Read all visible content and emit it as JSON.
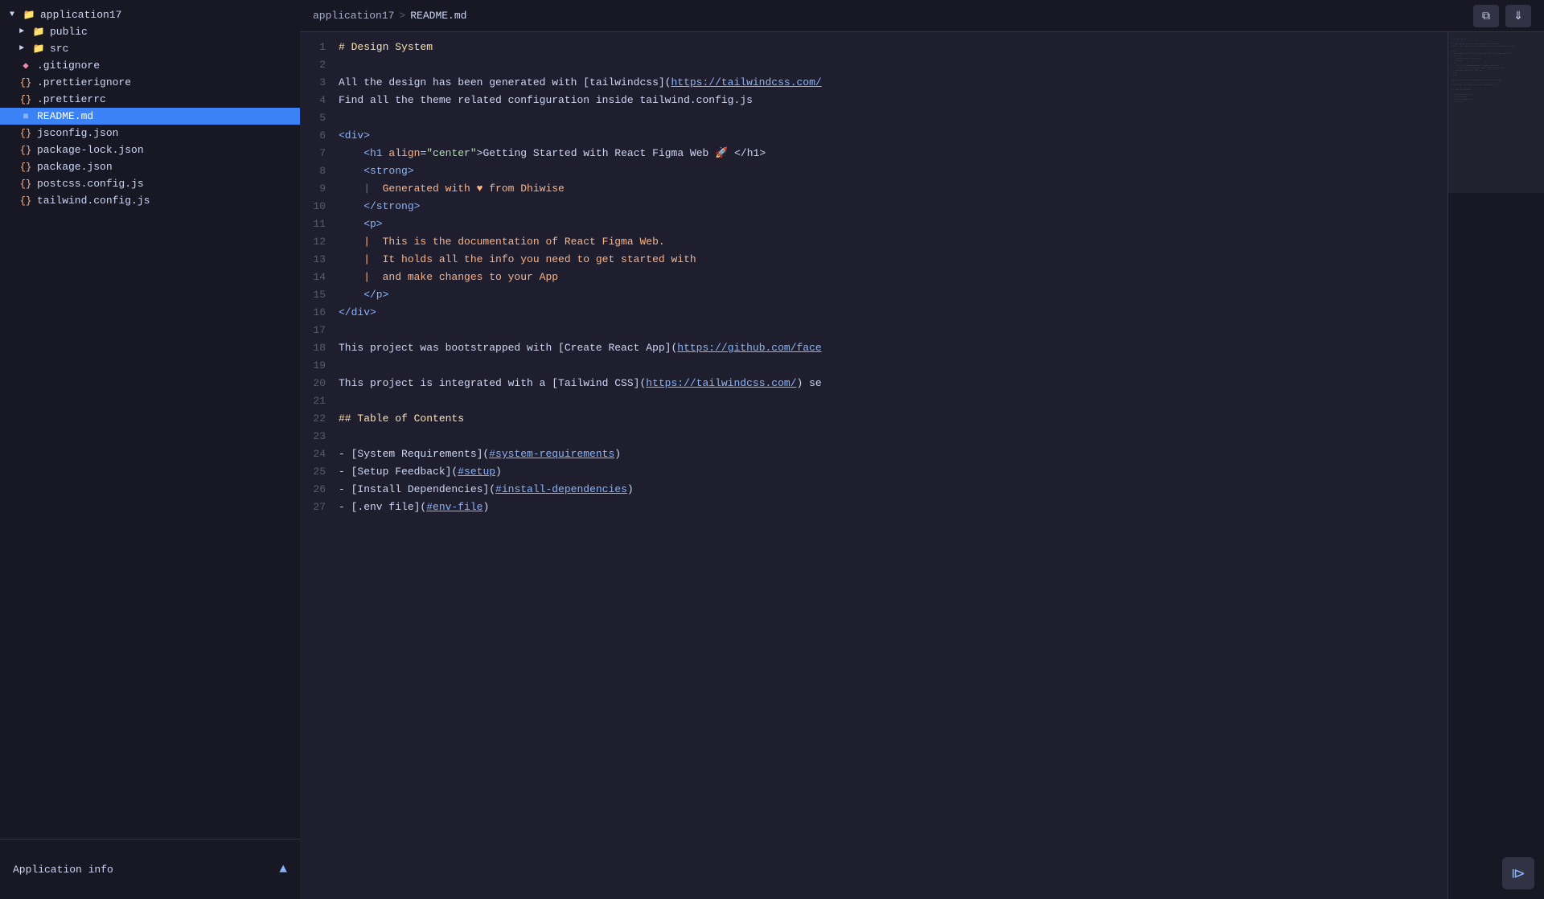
{
  "breadcrumb": {
    "root": "application17",
    "separator": ">",
    "file": "README.md"
  },
  "sidebar": {
    "title": "application17",
    "items": [
      {
        "id": "application17",
        "label": "application17",
        "type": "folder",
        "expanded": true,
        "indent": 0
      },
      {
        "id": "public",
        "label": "public",
        "type": "folder",
        "expanded": false,
        "indent": 1
      },
      {
        "id": "src",
        "label": "src",
        "type": "folder",
        "expanded": false,
        "indent": 1
      },
      {
        "id": "gitignore",
        "label": ".gitignore",
        "type": "diamond",
        "expanded": false,
        "indent": 1
      },
      {
        "id": "prettierignore",
        "label": ".prettierignore",
        "type": "braces",
        "expanded": false,
        "indent": 1
      },
      {
        "id": "prettierrc",
        "label": ".prettierrc",
        "type": "braces",
        "expanded": false,
        "indent": 1
      },
      {
        "id": "readmemd",
        "label": "README.md",
        "type": "circle",
        "expanded": false,
        "indent": 1,
        "active": true
      },
      {
        "id": "jsconfigjson",
        "label": "jsconfig.json",
        "type": "braces",
        "expanded": false,
        "indent": 1
      },
      {
        "id": "packagelockjson",
        "label": "package-lock.json",
        "type": "braces",
        "expanded": false,
        "indent": 1
      },
      {
        "id": "packagejson",
        "label": "package.json",
        "type": "braces",
        "expanded": false,
        "indent": 1
      },
      {
        "id": "postcssconfig",
        "label": "postcss.config.js",
        "type": "braces",
        "expanded": false,
        "indent": 1
      },
      {
        "id": "tailwindconfig",
        "label": "tailwind.config.js",
        "type": "braces",
        "expanded": false,
        "indent": 1
      }
    ],
    "footer": {
      "label": "Application info",
      "chevron": "^"
    }
  },
  "editor": {
    "lines": [
      {
        "num": 1,
        "tokens": [
          {
            "text": "# Design System",
            "class": "c-heading"
          }
        ]
      },
      {
        "num": 2,
        "tokens": []
      },
      {
        "num": 3,
        "tokens": [
          {
            "text": "All the design has been generated with [tailwindcss](",
            "class": "c-white"
          },
          {
            "text": "https://tailwindcss.com/",
            "class": "c-link"
          }
        ]
      },
      {
        "num": 4,
        "tokens": [
          {
            "text": "Find all the theme related configuration inside tailwind.config.js",
            "class": "c-white"
          }
        ]
      },
      {
        "num": 5,
        "tokens": []
      },
      {
        "num": 6,
        "tokens": [
          {
            "text": "<div>",
            "class": "c-tag"
          }
        ]
      },
      {
        "num": 7,
        "tokens": [
          {
            "text": "    <h1 ",
            "class": "c-tag"
          },
          {
            "text": "align",
            "class": "c-attr-name"
          },
          {
            "text": "=",
            "class": "c-white"
          },
          {
            "text": "\"center\"",
            "class": "c-attr-val"
          },
          {
            "text": ">Getting Started with React Figma Web 🚀 </h1>",
            "class": "c-inner"
          }
        ]
      },
      {
        "num": 8,
        "tokens": [
          {
            "text": "    <strong>",
            "class": "c-tag"
          }
        ]
      },
      {
        "num": 9,
        "tokens": [
          {
            "text": "    |  ",
            "class": "c-comment"
          },
          {
            "text": "Generated with ♥ from Dhiwise",
            "class": "c-emphasis"
          }
        ]
      },
      {
        "num": 10,
        "tokens": [
          {
            "text": "    </strong>",
            "class": "c-tag"
          }
        ]
      },
      {
        "num": 11,
        "tokens": [
          {
            "text": "    <p>",
            "class": "c-tag"
          }
        ]
      },
      {
        "num": 12,
        "tokens": [
          {
            "text": "    |  This is the documentation of React Figma Web.",
            "class": "c-emphasis"
          }
        ]
      },
      {
        "num": 13,
        "tokens": [
          {
            "text": "    |  It holds all the info you need to get started with",
            "class": "c-emphasis"
          }
        ]
      },
      {
        "num": 14,
        "tokens": [
          {
            "text": "    |  and make changes to your App",
            "class": "c-emphasis"
          }
        ]
      },
      {
        "num": 15,
        "tokens": [
          {
            "text": "    </p>",
            "class": "c-tag"
          }
        ]
      },
      {
        "num": 16,
        "tokens": [
          {
            "text": "</div>",
            "class": "c-tag"
          }
        ]
      },
      {
        "num": 17,
        "tokens": []
      },
      {
        "num": 18,
        "tokens": [
          {
            "text": "This project was bootstrapped with [Create React App](",
            "class": "c-white"
          },
          {
            "text": "https://github.com/face",
            "class": "c-link"
          }
        ]
      },
      {
        "num": 19,
        "tokens": []
      },
      {
        "num": 20,
        "tokens": [
          {
            "text": "This project is integrated with a [Tailwind CSS](",
            "class": "c-white"
          },
          {
            "text": "https://tailwindcss.com/",
            "class": "c-link"
          },
          {
            "text": ") se",
            "class": "c-white"
          }
        ]
      },
      {
        "num": 21,
        "tokens": []
      },
      {
        "num": 22,
        "tokens": [
          {
            "text": "## Table of Contents",
            "class": "c-heading"
          }
        ]
      },
      {
        "num": 23,
        "tokens": []
      },
      {
        "num": 24,
        "tokens": [
          {
            "text": "- [System Requirements](",
            "class": "c-white"
          },
          {
            "text": "#system-requirements",
            "class": "c-link"
          },
          {
            "text": ")",
            "class": "c-white"
          }
        ]
      },
      {
        "num": 25,
        "tokens": [
          {
            "text": "- [Setup Feedback](",
            "class": "c-white"
          },
          {
            "text": "#setup",
            "class": "c-link"
          },
          {
            "text": ")",
            "class": "c-white"
          }
        ]
      },
      {
        "num": 26,
        "tokens": [
          {
            "text": "- [Install Dependencies](",
            "class": "c-white"
          },
          {
            "text": "#install-dependencies",
            "class": "c-link"
          },
          {
            "text": ")",
            "class": "c-white"
          }
        ]
      },
      {
        "num": 27,
        "tokens": [
          {
            "text": "- [.env file](",
            "class": "c-white"
          },
          {
            "text": "#env-file",
            "class": "c-link"
          },
          {
            "text": ")",
            "class": "c-white"
          }
        ]
      }
    ]
  },
  "toolbar": {
    "copy_label": "⧉",
    "download_label": "⬇"
  },
  "bottom": {
    "folder_icon": "❐",
    "application_info_label": "Application info",
    "chevron_label": "^"
  }
}
